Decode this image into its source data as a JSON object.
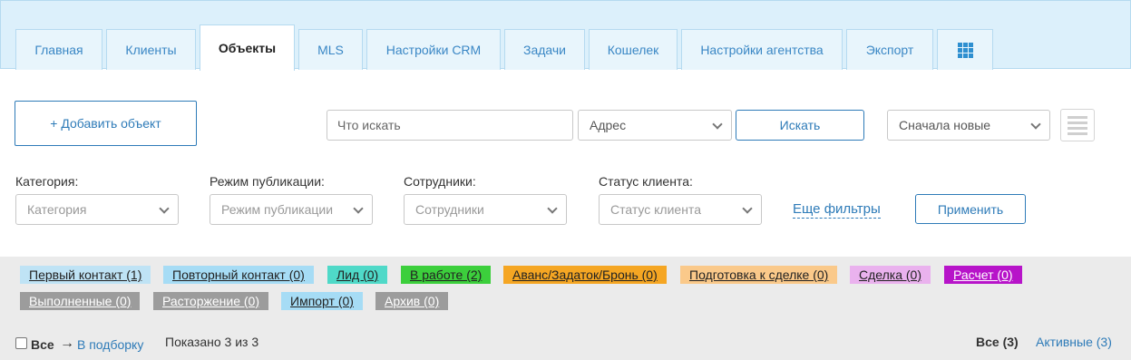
{
  "tabs": [
    {
      "label": "Главная",
      "active": false
    },
    {
      "label": "Клиенты",
      "active": false
    },
    {
      "label": "Объекты",
      "active": true
    },
    {
      "label": "MLS",
      "active": false
    },
    {
      "label": "Настройки CRM",
      "active": false
    },
    {
      "label": "Задачи",
      "active": false
    },
    {
      "label": "Кошелек",
      "active": false
    },
    {
      "label": "Настройки агентства",
      "active": false
    },
    {
      "label": "Экспорт",
      "active": false
    }
  ],
  "toolbar": {
    "add_label": "+ Добавить объект",
    "search_placeholder": "Что искать",
    "address_select": "Адрес",
    "search_button": "Искать",
    "sort_select": "Сначала новые"
  },
  "filters": {
    "category_label": "Категория:",
    "category_value": "Категория",
    "publication_label": "Режим публикации:",
    "publication_value": "Режим публикации",
    "staff_label": "Сотрудники:",
    "staff_value": "Сотрудники",
    "client_status_label": "Статус клиента:",
    "client_status_value": "Статус клиента",
    "more_filters": "Еще фильтры",
    "apply_button": "Применить"
  },
  "statuses": [
    {
      "label": "Первый контакт (1)",
      "color": "#bfe3f5"
    },
    {
      "label": "Повторный контакт (0)",
      "color": "#a6dcf5"
    },
    {
      "label": "Лид (0)",
      "color": "#4fd9c8"
    },
    {
      "label": "В работе (2)",
      "color": "#3ccf3c"
    },
    {
      "label": "Аванс/Задаток/Бронь (0)",
      "color": "#f5a623"
    },
    {
      "label": "Подготовка к сделке (0)",
      "color": "#fac98a"
    },
    {
      "label": "Сделка (0)",
      "color": "#eab2ee"
    },
    {
      "label": "Расчет (0)",
      "color": "#b714c9"
    },
    {
      "label": "Выполненные (0)",
      "color": "#9c9c9c"
    },
    {
      "label": "Расторжение (0)",
      "color": "#9c9c9c"
    },
    {
      "label": "Импорт (0)",
      "color": "#a6dcf5"
    },
    {
      "label": "Архив (0)",
      "color": "#9c9c9c"
    }
  ],
  "footer": {
    "select_all": "Все",
    "arrow": "→",
    "to_selection": "В подборку",
    "shown": "Показано 3 из 3",
    "all_count": "Все (3)",
    "active_count": "Активные (3)"
  }
}
